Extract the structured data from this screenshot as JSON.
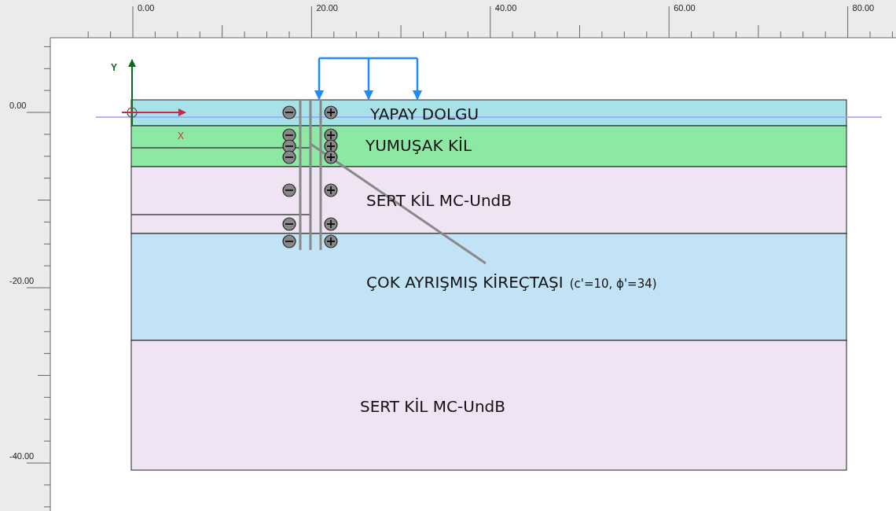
{
  "rulers": {
    "horizontal": [
      "0.00",
      "20.00",
      "40.00",
      "60.00",
      "80.00"
    ],
    "vertical": [
      "0.00",
      "-20.00",
      "-40.00"
    ]
  },
  "axes": {
    "x_label": "X",
    "y_label": "Y"
  },
  "layers": [
    {
      "name": "YAPAY DOLGU",
      "color": "#a6e2e8"
    },
    {
      "name": "YUMUŞAK KİL",
      "color": "#8ce8a2"
    },
    {
      "name": "SERT KİL MC-UndB",
      "color": "#f0e3f4"
    },
    {
      "name": "ÇOK AYRIŞMIŞ KİREÇTAŞI",
      "note": "(c'=10, ϕ'=34)",
      "color": "#c2e3f6"
    },
    {
      "name": "SERT KİL MC-UndB",
      "color": "#f0e3f4"
    }
  ]
}
